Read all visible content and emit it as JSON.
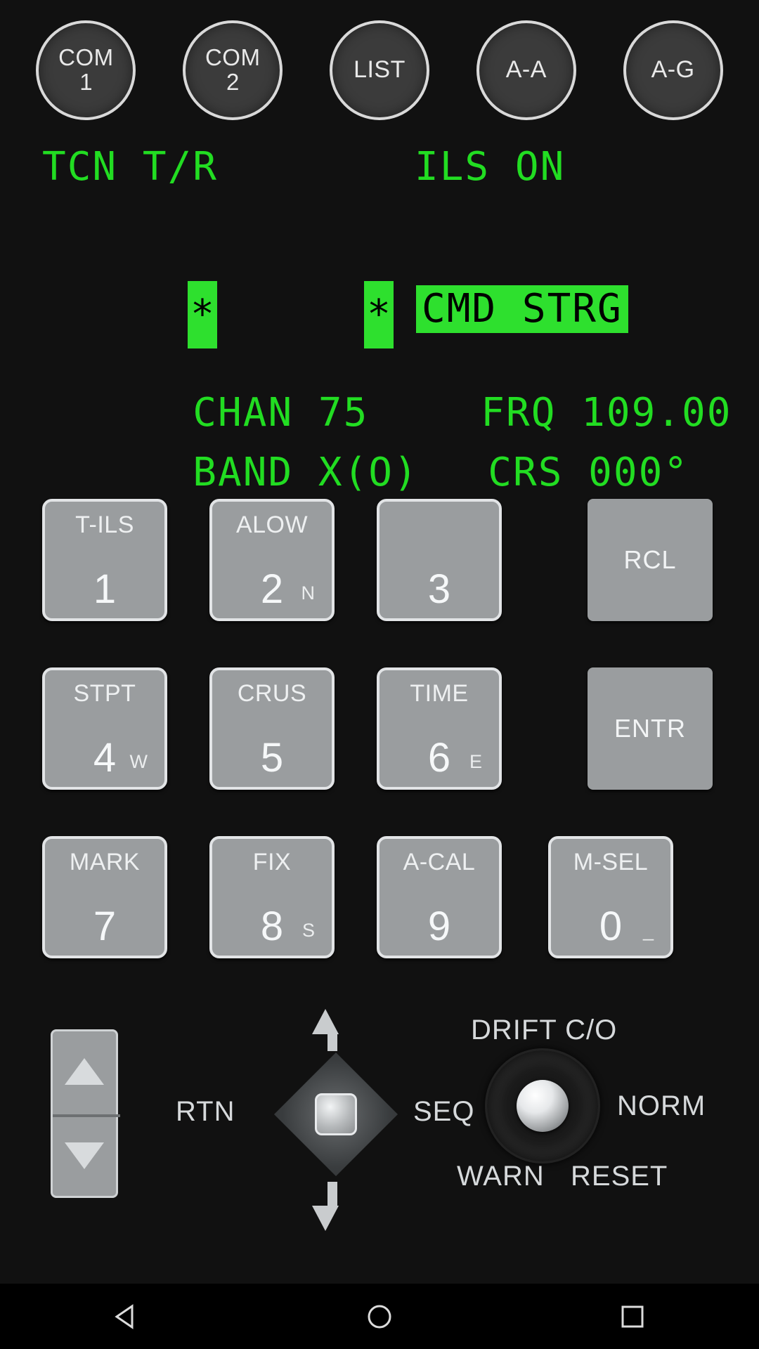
{
  "top_buttons": [
    {
      "name": "com1",
      "line1": "COM",
      "line2": "1"
    },
    {
      "name": "com2",
      "line1": "COM",
      "line2": "2"
    },
    {
      "name": "list",
      "line1": "LIST",
      "line2": ""
    },
    {
      "name": "aa",
      "line1": "A-A",
      "line2": ""
    },
    {
      "name": "ag",
      "line1": "A-G",
      "line2": ""
    }
  ],
  "display": {
    "color_green": "#22dd22",
    "color_highlight_bg": "#2ee02e",
    "mode": "TCN T/R",
    "ils": "ILS ON",
    "star_left": "*",
    "star_right": "*",
    "cmd_strg": "CMD STRG",
    "chan_label": "CHAN",
    "chan_value": "75",
    "frq_label": "FRQ",
    "frq_value": "109.00",
    "band_label": "BAND",
    "band_value": "X(O)",
    "crs_label": "CRS",
    "crs_value": "000°"
  },
  "keypad": [
    {
      "name": "t-ils-1",
      "top": "T-ILS",
      "big": "1",
      "sub": ""
    },
    {
      "name": "alow-2",
      "top": "ALOW",
      "big": "2",
      "sub": "N"
    },
    {
      "name": "key-3",
      "top": "",
      "big": "3",
      "sub": ""
    },
    {
      "name": "rcl",
      "top": "",
      "big": "",
      "sub": "",
      "plain": "RCL"
    },
    {
      "name": "stpt-4",
      "top": "STPT",
      "big": "4",
      "sub": "W"
    },
    {
      "name": "crus-5",
      "top": "CRUS",
      "big": "5",
      "sub": ""
    },
    {
      "name": "time-6",
      "top": "TIME",
      "big": "6",
      "sub": "E"
    },
    {
      "name": "entr",
      "top": "",
      "big": "",
      "sub": "",
      "plain": "ENTR"
    },
    {
      "name": "mark-7",
      "top": "MARK",
      "big": "7",
      "sub": ""
    },
    {
      "name": "fix-8",
      "top": "FIX",
      "big": "8",
      "sub": "S"
    },
    {
      "name": "a-cal-9",
      "top": "A-CAL",
      "big": "9",
      "sub": ""
    },
    {
      "name": "m-sel-0",
      "top": "M-SEL",
      "big": "0",
      "sub": "_"
    }
  ],
  "bottom": {
    "rocker_up": "▲",
    "rocker_down": "▼",
    "hat_left_label": "RTN",
    "hat_right_label": "SEQ",
    "knob_top_label": "DRIFT C/O",
    "knob_right_label": "NORM",
    "knob_bottom_left_label": "WARN",
    "knob_bottom_right_label": "RESET"
  },
  "navbar": {
    "back": "back-icon",
    "home": "home-icon",
    "recent": "recents-icon"
  }
}
